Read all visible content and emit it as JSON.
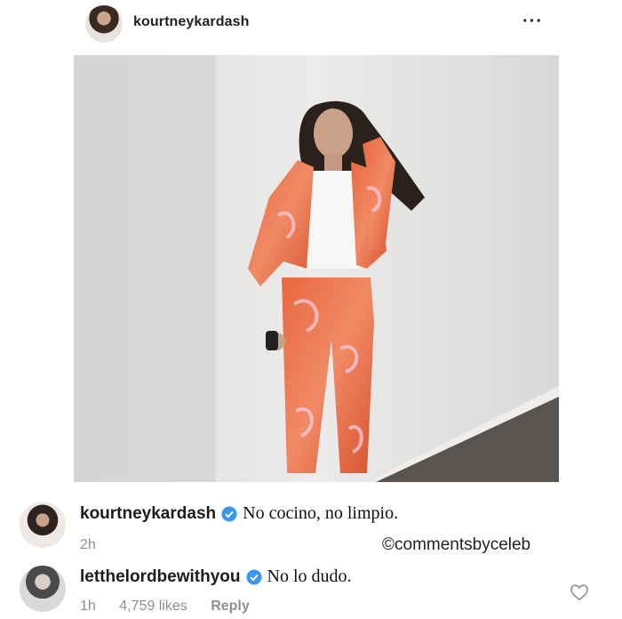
{
  "post": {
    "username": "kourtneykardash",
    "more_icon": "more-horizontal-icon",
    "more_glyph": "···"
  },
  "comments": [
    {
      "username": "kourtneykardash",
      "verified": true,
      "text": "No cocino, no limpio.",
      "time": "2h"
    },
    {
      "username": "letthelordbewithyou",
      "verified": true,
      "text": "No lo dudo.",
      "time": "1h",
      "likes": "4,759 likes",
      "reply_label": "Reply"
    }
  ],
  "watermark": "©commentsbyceleb",
  "colors": {
    "verified_blue": "#3897f0",
    "meta_gray": "#8e8e8e"
  }
}
